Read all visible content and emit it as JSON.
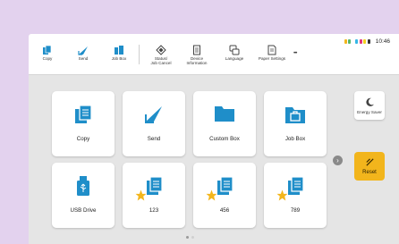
{
  "toolbar": {
    "items": [
      {
        "label": "Copy",
        "icon": "copy-icon"
      },
      {
        "label": "Send",
        "icon": "send-icon"
      },
      {
        "label": "Job Box",
        "icon": "job-box-icon"
      },
      {
        "label": "Status/\nJob Cancel",
        "icon": "status-icon"
      },
      {
        "label": "Device\nInformation",
        "icon": "device-info-icon"
      },
      {
        "label": "Language",
        "icon": "language-icon"
      },
      {
        "label": "Paper Settings",
        "icon": "paper-settings-icon"
      }
    ],
    "more_label": "•••"
  },
  "status": {
    "time": "10:46"
  },
  "tiles": [
    {
      "label": "Copy",
      "icon": "copy-icon"
    },
    {
      "label": "Send",
      "icon": "send-icon"
    },
    {
      "label": "Custom Box",
      "icon": "folder-icon"
    },
    {
      "label": "Job Box",
      "icon": "job-box-folder-icon"
    },
    {
      "label": "USB Drive",
      "icon": "usb-drive-icon"
    },
    {
      "label": "123",
      "icon": "favorite-program-icon"
    },
    {
      "label": "456",
      "icon": "favorite-program-icon"
    },
    {
      "label": "789",
      "icon": "favorite-program-icon"
    }
  ],
  "side": {
    "energy_saver_label": "Energy Saver",
    "reset_label": "Reset"
  },
  "colors": {
    "accent_blue": "#1f8ec9",
    "reset_yellow": "#f2b51c",
    "star_yellow": "#f3b61d",
    "background_purple": "#e3d2ee"
  },
  "pager": {
    "page_count": 2,
    "current_page": 1
  }
}
